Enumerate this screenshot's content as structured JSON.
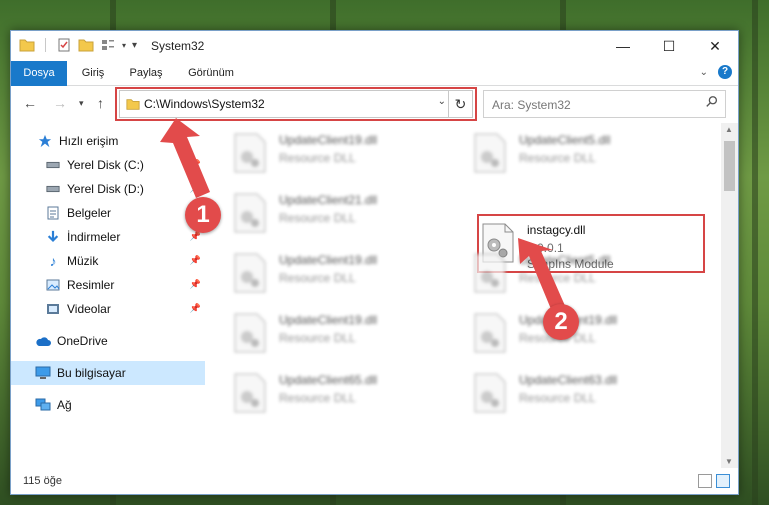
{
  "window": {
    "title": "System32"
  },
  "ribbon": {
    "tabs": [
      "Dosya",
      "Giriş",
      "Paylaş",
      "Görünüm"
    ]
  },
  "nav": {
    "address": "C:\\Windows\\System32",
    "search_placeholder": "Ara: System32"
  },
  "sidebar": {
    "items": [
      {
        "label": "Hızlı erişim",
        "icon": "star-icon",
        "pinned": false
      },
      {
        "label": "Yerel Disk (C:)",
        "icon": "drive-icon",
        "pinned": true
      },
      {
        "label": "Yerel Disk (D:)",
        "icon": "drive-icon",
        "pinned": true
      },
      {
        "label": "Belgeler",
        "icon": "documents-icon",
        "pinned": true
      },
      {
        "label": "İndirmeler",
        "icon": "download-icon",
        "pinned": true
      },
      {
        "label": "Müzik",
        "icon": "music-icon",
        "pinned": true
      },
      {
        "label": "Resimler",
        "icon": "pictures-icon",
        "pinned": true
      },
      {
        "label": "Videolar",
        "icon": "videos-icon",
        "pinned": true
      },
      {
        "label": "OneDrive",
        "icon": "cloud-icon",
        "pinned": false
      },
      {
        "label": "Bu bilgisayar",
        "icon": "computer-icon",
        "pinned": false
      },
      {
        "label": "Ağ",
        "icon": "network-icon",
        "pinned": false
      }
    ]
  },
  "files": [
    {
      "name": "UpdateClient19.dll",
      "line2": "Resource DLL",
      "line3": "",
      "blurred": true
    },
    {
      "name": "UpdateClient5.dll",
      "line2": "Resource DLL",
      "line3": "",
      "blurred": true
    },
    {
      "name": "UpdateClient21.dll",
      "line2": "Resource DLL",
      "line3": "",
      "blurred": true
    },
    {
      "name": "instagcy.dll",
      "line2": "6.0.0.1",
      "line3": "SnapIns Module",
      "blurred": false
    },
    {
      "name": "UpdateClient19.dll",
      "line2": "Resource DLL",
      "line3": "",
      "blurred": true
    },
    {
      "name": "UpdateClient5.dll",
      "line2": "Resource DLL",
      "line3": "",
      "blurred": true
    },
    {
      "name": "UpdateClient19.dll",
      "line2": "Resource DLL",
      "line3": "",
      "blurred": true
    },
    {
      "name": "UpdateClient19.dll",
      "line2": "Resource DLL",
      "line3": "",
      "blurred": true
    },
    {
      "name": "UpdateClient65.dll",
      "line2": "Resource DLL",
      "line3": "",
      "blurred": true
    },
    {
      "name": "UpdateClient63.dll",
      "line2": "Resource DLL",
      "line3": "",
      "blurred": true
    }
  ],
  "status": {
    "count": "115 öğe"
  },
  "annotations": {
    "step1": "1",
    "step2": "2",
    "color": "#e24b4b"
  }
}
